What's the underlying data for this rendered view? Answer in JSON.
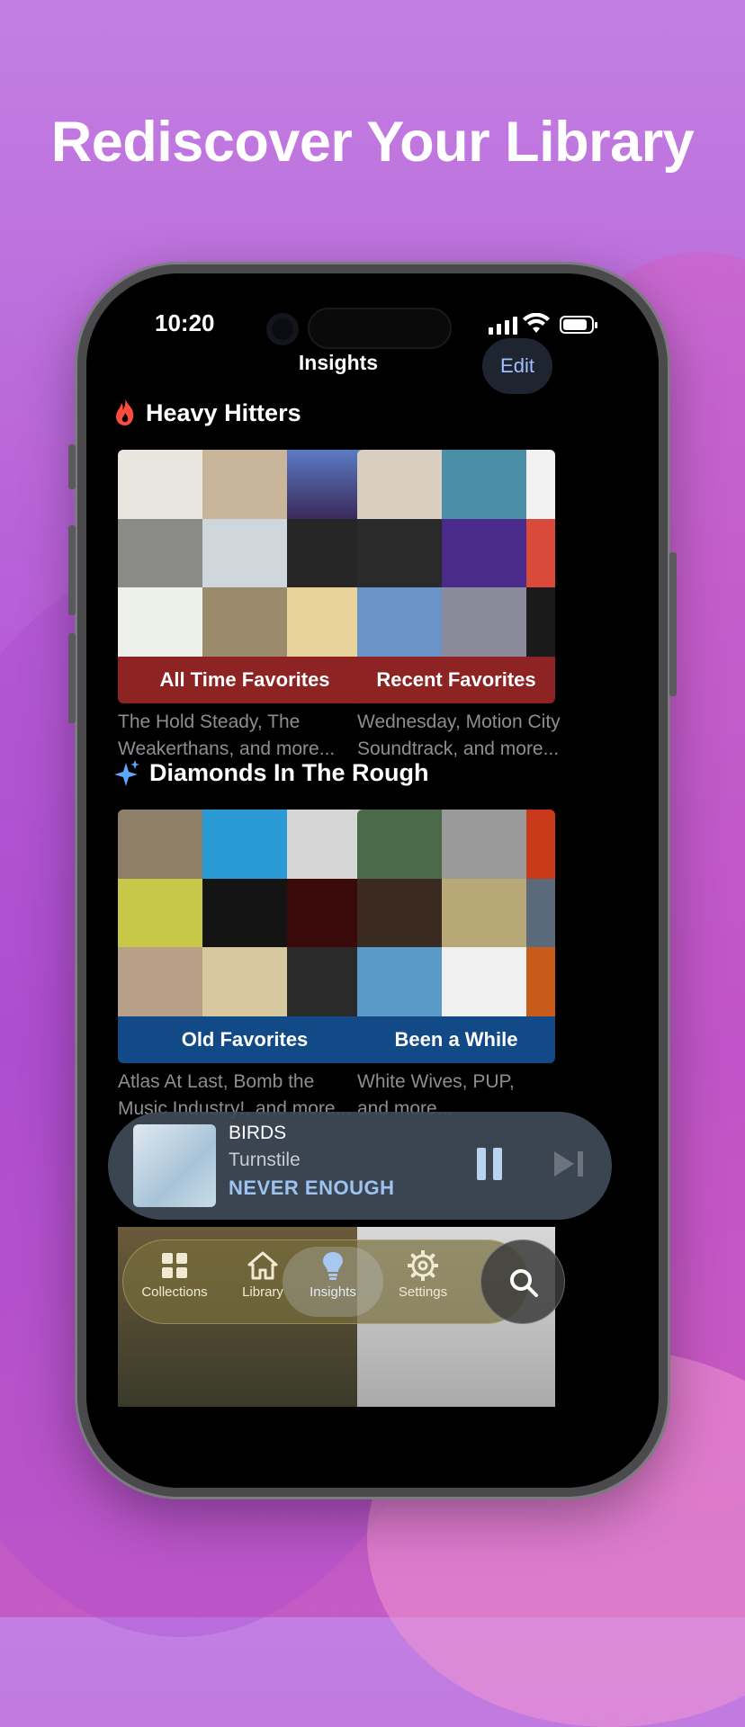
{
  "headline": "Rediscover Your Library",
  "status": {
    "time": "10:20"
  },
  "nav": {
    "title": "Insights",
    "edit_label": "Edit"
  },
  "sections": [
    {
      "title": "Heavy Hitters",
      "icon": "flame-icon",
      "cards": [
        {
          "label": "All Time Favorites",
          "subtitle_line1": "The Hold Steady, The",
          "subtitle_line2": "Weakerthans, and more..."
        },
        {
          "label": "Recent Favorites",
          "subtitle_line1": "Wednesday, Motion City",
          "subtitle_line2": "Soundtrack, and more..."
        }
      ]
    },
    {
      "title": "Diamonds In The Rough",
      "icon": "sparkles-icon",
      "cards": [
        {
          "label": "Old Favorites",
          "subtitle_line1": "Atlas At Last, Bomb the",
          "subtitle_line2": "Music Industry!, and more..."
        },
        {
          "label": "Been a While",
          "subtitle_line1": "White Wives, PUP,",
          "subtitle_line2": "and more..."
        }
      ]
    }
  ],
  "now_playing": {
    "line1": "BIRDS",
    "line2": "Turnstile",
    "line3": "NEVER ENOUGH"
  },
  "tabs": [
    {
      "label": "Collections",
      "icon": "grid-icon"
    },
    {
      "label": "Library",
      "icon": "house-icon"
    },
    {
      "label": "Insights",
      "icon": "lightbulb-icon"
    },
    {
      "label": "Settings",
      "icon": "gear-icon"
    }
  ],
  "colors": {
    "label_red": "#8e2323",
    "label_blue": "#114a86",
    "accent": "#9fc0ff"
  }
}
